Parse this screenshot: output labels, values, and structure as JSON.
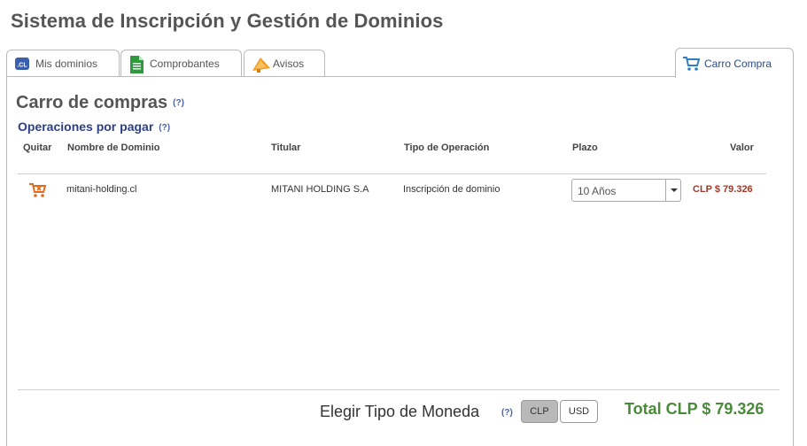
{
  "page": {
    "title": "Sistema de Inscripción y Gestión de Dominios"
  },
  "tabs": [
    {
      "label": "Mis dominios",
      "icon": "cl-domain-icon"
    },
    {
      "label": "Comprobantes",
      "icon": "document-icon"
    },
    {
      "label": "Avisos",
      "icon": "megaphone-icon"
    },
    {
      "label": "Carro Compra",
      "icon": "cart-icon",
      "active": true
    }
  ],
  "cart": {
    "title": "Carro de compras",
    "help": "(?)",
    "section_title": "Operaciones por pagar",
    "columns": {
      "quitar": "Quitar",
      "nombre": "Nombre de Dominio",
      "titular": "Titular",
      "tipo": "Tipo de Operación",
      "plazo": "Plazo",
      "valor": "Valor"
    },
    "rows": [
      {
        "domain": "mitani-holding.cl",
        "titular": "MITANI HOLDING S.A",
        "tipo": "Inscripción de dominio",
        "plazo": "10 Años",
        "valor": "CLP $ 79.326"
      }
    ]
  },
  "currency": {
    "label": "Elegir Tipo de Moneda",
    "help": "(?)",
    "options": [
      "CLP",
      "USD"
    ],
    "selected": "CLP"
  },
  "total": "Total CLP $ 79.326",
  "colors": {
    "accent_blue": "#2c3f86",
    "price_red": "#a0392a",
    "total_green": "#4a8a3a",
    "cart_orange": "#e06b1f"
  }
}
